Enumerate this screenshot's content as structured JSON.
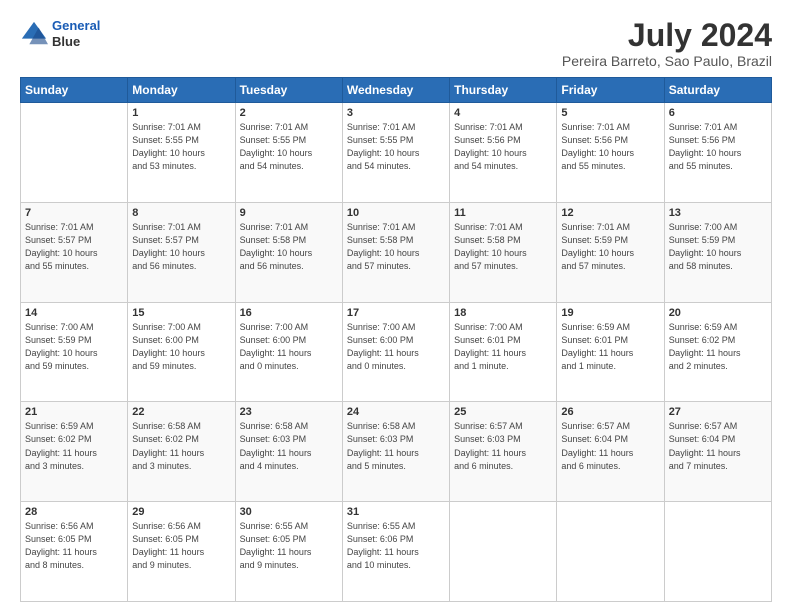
{
  "header": {
    "logo_line1": "General",
    "logo_line2": "Blue",
    "title": "July 2024",
    "subtitle": "Pereira Barreto, Sao Paulo, Brazil"
  },
  "weekdays": [
    "Sunday",
    "Monday",
    "Tuesday",
    "Wednesday",
    "Thursday",
    "Friday",
    "Saturday"
  ],
  "weeks": [
    [
      {
        "day": "",
        "info": ""
      },
      {
        "day": "1",
        "info": "Sunrise: 7:01 AM\nSunset: 5:55 PM\nDaylight: 10 hours\nand 53 minutes."
      },
      {
        "day": "2",
        "info": "Sunrise: 7:01 AM\nSunset: 5:55 PM\nDaylight: 10 hours\nand 54 minutes."
      },
      {
        "day": "3",
        "info": "Sunrise: 7:01 AM\nSunset: 5:55 PM\nDaylight: 10 hours\nand 54 minutes."
      },
      {
        "day": "4",
        "info": "Sunrise: 7:01 AM\nSunset: 5:56 PM\nDaylight: 10 hours\nand 54 minutes."
      },
      {
        "day": "5",
        "info": "Sunrise: 7:01 AM\nSunset: 5:56 PM\nDaylight: 10 hours\nand 55 minutes."
      },
      {
        "day": "6",
        "info": "Sunrise: 7:01 AM\nSunset: 5:56 PM\nDaylight: 10 hours\nand 55 minutes."
      }
    ],
    [
      {
        "day": "7",
        "info": "Sunrise: 7:01 AM\nSunset: 5:57 PM\nDaylight: 10 hours\nand 55 minutes."
      },
      {
        "day": "8",
        "info": "Sunrise: 7:01 AM\nSunset: 5:57 PM\nDaylight: 10 hours\nand 56 minutes."
      },
      {
        "day": "9",
        "info": "Sunrise: 7:01 AM\nSunset: 5:58 PM\nDaylight: 10 hours\nand 56 minutes."
      },
      {
        "day": "10",
        "info": "Sunrise: 7:01 AM\nSunset: 5:58 PM\nDaylight: 10 hours\nand 57 minutes."
      },
      {
        "day": "11",
        "info": "Sunrise: 7:01 AM\nSunset: 5:58 PM\nDaylight: 10 hours\nand 57 minutes."
      },
      {
        "day": "12",
        "info": "Sunrise: 7:01 AM\nSunset: 5:59 PM\nDaylight: 10 hours\nand 57 minutes."
      },
      {
        "day": "13",
        "info": "Sunrise: 7:00 AM\nSunset: 5:59 PM\nDaylight: 10 hours\nand 58 minutes."
      }
    ],
    [
      {
        "day": "14",
        "info": "Sunrise: 7:00 AM\nSunset: 5:59 PM\nDaylight: 10 hours\nand 59 minutes."
      },
      {
        "day": "15",
        "info": "Sunrise: 7:00 AM\nSunset: 6:00 PM\nDaylight: 10 hours\nand 59 minutes."
      },
      {
        "day": "16",
        "info": "Sunrise: 7:00 AM\nSunset: 6:00 PM\nDaylight: 11 hours\nand 0 minutes."
      },
      {
        "day": "17",
        "info": "Sunrise: 7:00 AM\nSunset: 6:00 PM\nDaylight: 11 hours\nand 0 minutes."
      },
      {
        "day": "18",
        "info": "Sunrise: 7:00 AM\nSunset: 6:01 PM\nDaylight: 11 hours\nand 1 minute."
      },
      {
        "day": "19",
        "info": "Sunrise: 6:59 AM\nSunset: 6:01 PM\nDaylight: 11 hours\nand 1 minute."
      },
      {
        "day": "20",
        "info": "Sunrise: 6:59 AM\nSunset: 6:02 PM\nDaylight: 11 hours\nand 2 minutes."
      }
    ],
    [
      {
        "day": "21",
        "info": "Sunrise: 6:59 AM\nSunset: 6:02 PM\nDaylight: 11 hours\nand 3 minutes."
      },
      {
        "day": "22",
        "info": "Sunrise: 6:58 AM\nSunset: 6:02 PM\nDaylight: 11 hours\nand 3 minutes."
      },
      {
        "day": "23",
        "info": "Sunrise: 6:58 AM\nSunset: 6:03 PM\nDaylight: 11 hours\nand 4 minutes."
      },
      {
        "day": "24",
        "info": "Sunrise: 6:58 AM\nSunset: 6:03 PM\nDaylight: 11 hours\nand 5 minutes."
      },
      {
        "day": "25",
        "info": "Sunrise: 6:57 AM\nSunset: 6:03 PM\nDaylight: 11 hours\nand 6 minutes."
      },
      {
        "day": "26",
        "info": "Sunrise: 6:57 AM\nSunset: 6:04 PM\nDaylight: 11 hours\nand 6 minutes."
      },
      {
        "day": "27",
        "info": "Sunrise: 6:57 AM\nSunset: 6:04 PM\nDaylight: 11 hours\nand 7 minutes."
      }
    ],
    [
      {
        "day": "28",
        "info": "Sunrise: 6:56 AM\nSunset: 6:05 PM\nDaylight: 11 hours\nand 8 minutes."
      },
      {
        "day": "29",
        "info": "Sunrise: 6:56 AM\nSunset: 6:05 PM\nDaylight: 11 hours\nand 9 minutes."
      },
      {
        "day": "30",
        "info": "Sunrise: 6:55 AM\nSunset: 6:05 PM\nDaylight: 11 hours\nand 9 minutes."
      },
      {
        "day": "31",
        "info": "Sunrise: 6:55 AM\nSunset: 6:06 PM\nDaylight: 11 hours\nand 10 minutes."
      },
      {
        "day": "",
        "info": ""
      },
      {
        "day": "",
        "info": ""
      },
      {
        "day": "",
        "info": ""
      }
    ]
  ]
}
